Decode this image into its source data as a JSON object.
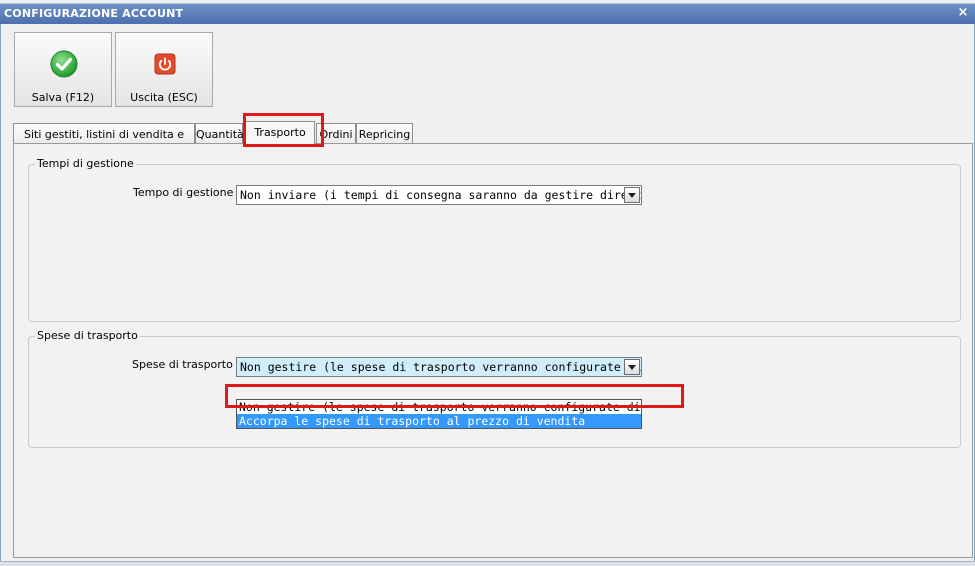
{
  "window": {
    "title": "CONFIGURAZIONE ACCOUNT",
    "close": "×"
  },
  "toolbar": {
    "save": {
      "label": "Salva (F12)",
      "icon": "check-icon",
      "color": "#39b54a"
    },
    "exit": {
      "label": "Uscita (ESC)",
      "icon": "power-icon",
      "color": "#e04a2f"
    }
  },
  "tabs": [
    {
      "label": "Siti gestiti, listini di vendita e lingue"
    },
    {
      "label": "Quantità"
    },
    {
      "label": "Trasporto",
      "active": true
    },
    {
      "label": "Ordini"
    },
    {
      "label": "Repricing"
    }
  ],
  "groups": {
    "tempi": {
      "title": "Tempi di gestione",
      "field_label": "Tempo di gestione :",
      "value": "Non inviare (i tempi di consegna saranno da gestire direttamente s"
    },
    "spese": {
      "title": "Spese di trasporto",
      "field_label": "Spese di trasporto :",
      "value": "Non gestire (le spese di trasporto verranno configurate direttamente",
      "options": [
        "Non gestire (le spese di trasporto verranno configurate direttamente s",
        "Accorpa le spese di trasporto al prezzo di vendita"
      ]
    }
  },
  "colors": {
    "highlight_box": "#e01818",
    "selection": "#3399ff"
  }
}
